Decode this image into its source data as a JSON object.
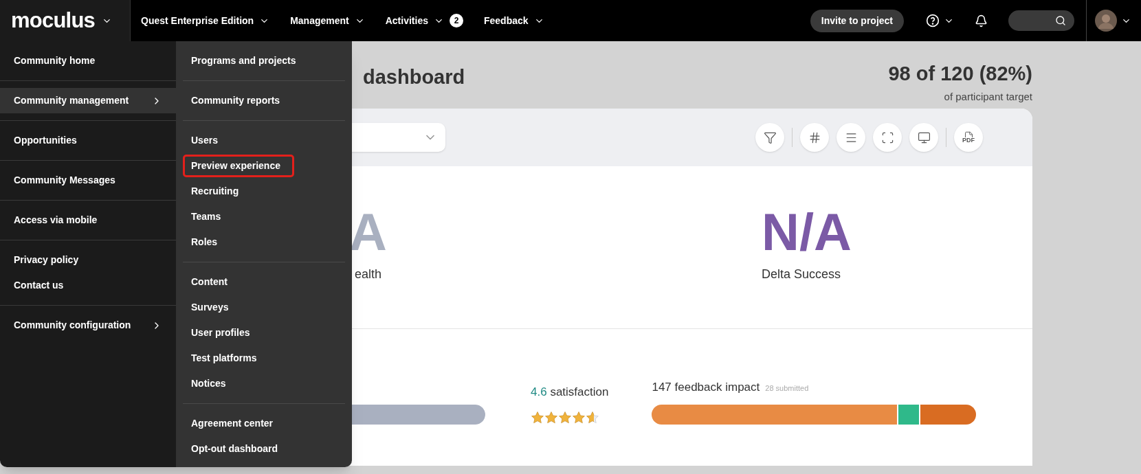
{
  "logo": "moculus",
  "nav": [
    {
      "label": "Quest Enterprise Edition"
    },
    {
      "label": "Management"
    },
    {
      "label": "Activities",
      "badge": "2"
    },
    {
      "label": "Feedback"
    }
  ],
  "invite_button": "Invite to project",
  "page": {
    "title": "dashboard",
    "target": "98 of 120 (82%)",
    "target_caption": "of participant target"
  },
  "toolbar": {
    "pdf_label": "PDF"
  },
  "metrics": [
    {
      "value": "A",
      "label": "ealth",
      "kind": "muted"
    },
    {
      "value": "N/A",
      "label": "Delta Success",
      "kind": "accent"
    }
  ],
  "health_bar": {
    "level": 1
  },
  "satisfaction": {
    "score": "4.6",
    "label": "satisfaction",
    "stars": 4.6
  },
  "feedback": {
    "title": "147 feedback impact",
    "submitted": "28 submitted"
  },
  "menu": {
    "primary": [
      [
        {
          "label": "Community home",
          "selected": false,
          "submenu": false
        }
      ],
      [
        {
          "label": "Community management",
          "selected": true,
          "submenu": true
        }
      ],
      [
        {
          "label": "Opportunities",
          "selected": false,
          "submenu": false
        }
      ],
      [
        {
          "label": "Community Messages",
          "selected": false,
          "submenu": false
        }
      ],
      [
        {
          "label": "Access via mobile",
          "selected": false,
          "submenu": false
        }
      ],
      [
        {
          "label": "Privacy policy",
          "selected": false,
          "submenu": false
        },
        {
          "label": "Contact us",
          "selected": false,
          "submenu": false
        }
      ],
      [
        {
          "label": "Community configuration",
          "selected": false,
          "submenu": true
        }
      ]
    ],
    "secondary": [
      [
        {
          "label": "Programs and projects",
          "highlighted": false
        }
      ],
      [
        {
          "label": "Community reports",
          "highlighted": false
        }
      ],
      [
        {
          "label": "Users",
          "highlighted": false
        },
        {
          "label": "Preview experience",
          "highlighted": true
        },
        {
          "label": "Recruiting",
          "highlighted": false
        },
        {
          "label": "Teams",
          "highlighted": false
        },
        {
          "label": "Roles",
          "highlighted": false
        }
      ],
      [
        {
          "label": "Content",
          "highlighted": false
        },
        {
          "label": "Surveys",
          "highlighted": false
        },
        {
          "label": "User profiles",
          "highlighted": false
        },
        {
          "label": "Test platforms",
          "highlighted": false
        },
        {
          "label": "Notices",
          "highlighted": false
        }
      ],
      [
        {
          "label": "Agreement center",
          "highlighted": false
        },
        {
          "label": "Opt-out dashboard",
          "highlighted": false
        }
      ]
    ]
  }
}
